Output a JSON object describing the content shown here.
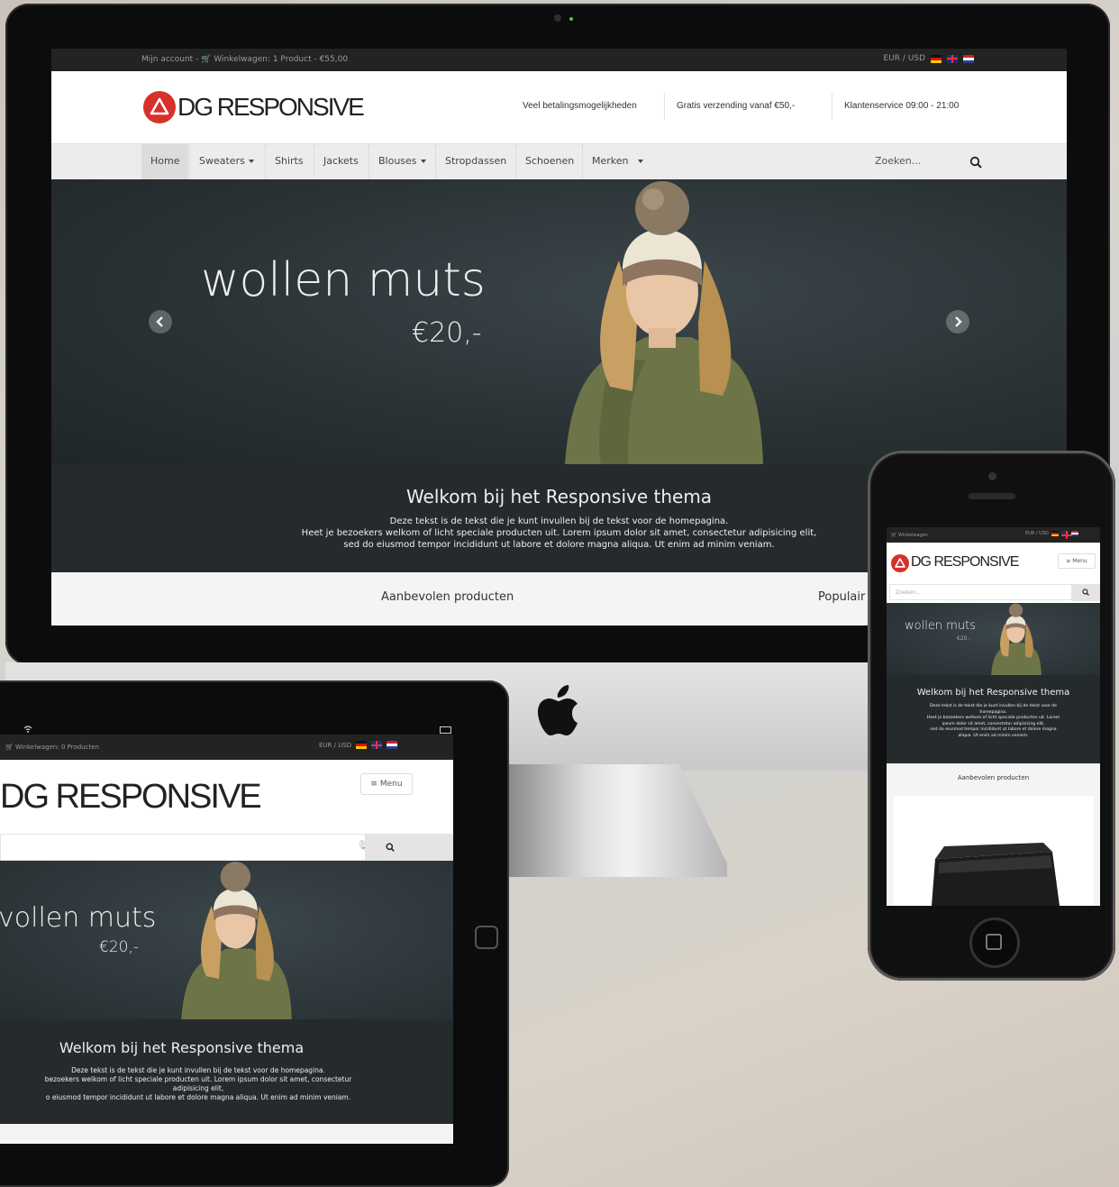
{
  "desktop": {
    "topbar": {
      "account": "Mijn account",
      "sep": "-",
      "cart": "Winkelwagen: 1 Product - €55,00",
      "currency": "EUR / USD"
    },
    "header": {
      "logo": "DG RESPONSIVE",
      "usp1": "Veel betalingsmogelijkheden",
      "usp2": "Gratis verzending vanaf €50,-",
      "usp3": "Klantenservice 09:00 - 21:00"
    },
    "nav": {
      "items": [
        "Home",
        "Sweaters",
        "Shirts",
        "Jackets",
        "Blouses",
        "Stropdassen",
        "Schoenen",
        "Merken"
      ],
      "search_placeholder": "Zoeken..."
    },
    "hero": {
      "title": "wollen muts",
      "price": "€20,-"
    },
    "welcome": {
      "title": "Welkom bij het Responsive thema",
      "line1": "Deze tekst is de tekst die je kunt invullen bij de tekst voor de homepagina.",
      "line2": "Heet je bezoekers welkom of licht speciale producten uit. Lorem ipsum dolor sit amet, consectetur adipisicing elit,",
      "line3": "sed do eiusmod tempor incididunt ut labore et dolore magna aliqua. Ut enim ad minim veniam."
    },
    "tabs": {
      "featured": "Aanbevolen producten",
      "popular": "Populair"
    }
  },
  "tablet": {
    "topbar": {
      "cart": "Winkelwagen: 0 Producten",
      "currency": "EUR / USD"
    },
    "logo": "DG RESPONSIVE",
    "menu": "Menu",
    "hero_title": "vollen muts",
    "hero_price": "€20,-",
    "welcome_title": "Welkom bij het Responsive thema",
    "line1": "Deze tekst is de tekst die je kunt invullen bij de tekst voor de homepagina.",
    "line2": "bezoekers welkom of licht speciale producten uit. Lorem ipsum dolor sit amet, consectetur",
    "line3": "adipisicing elit,",
    "line4": "o eiusmod tempor incididunt ut labore et dolore magna aliqua. Ut enim ad minim veniam."
  },
  "phone": {
    "topbar": {
      "cart": "Winkelwagen",
      "currency": "EUR / USD"
    },
    "logo": "DG RESPONSIVE",
    "menu": "Menu",
    "search_placeholder": "Zoeken...",
    "hero_title": "wollen muts",
    "hero_price": "€20,-",
    "welcome_title": "Welkom bij het Responsive thema",
    "line1": "Deze tekst is de tekst die je kunt invullen bij de tekst voor de",
    "line2": "homepagina.",
    "line3": "Heet je bezoekers welkom of licht speciale producten uit. Lorem",
    "line4": "ipsum dolor sit amet, consectetur adipisicing elit,",
    "line5": "sed do eiusmod tempor incididunt ut labore et dolore magna",
    "line6": "aliqua. Ut enim ad minim veniam.",
    "featured": "Aanbevolen producten"
  },
  "colors": {
    "brand_red": "#d7312a",
    "hero_bg": "#2a3235",
    "topbar_bg": "#232323"
  }
}
